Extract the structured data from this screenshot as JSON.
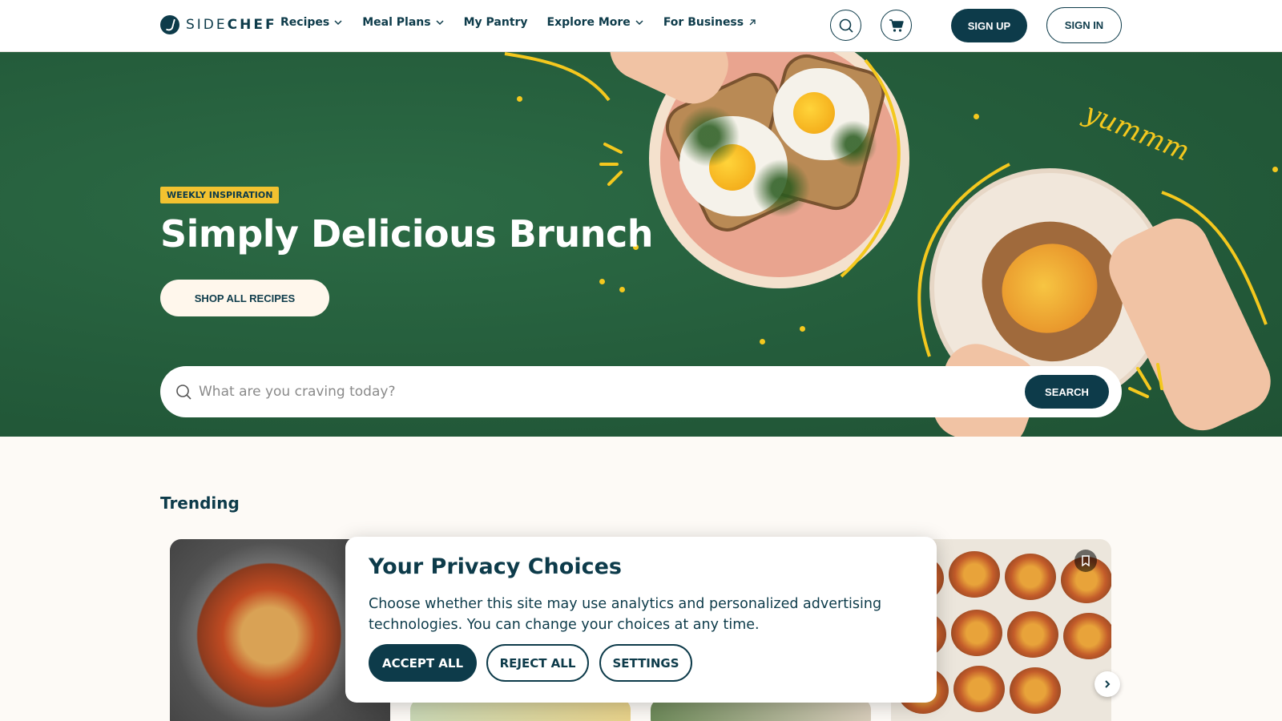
{
  "brand": {
    "light": "SIDE",
    "bold": "CHEF"
  },
  "nav": {
    "items": [
      {
        "label": "Recipes",
        "has_dropdown": true
      },
      {
        "label": "Meal Plans",
        "has_dropdown": true
      },
      {
        "label": "My Pantry",
        "has_dropdown": false
      },
      {
        "label": "Explore More",
        "has_dropdown": true
      },
      {
        "label": "For Business",
        "external": true
      }
    ],
    "sign_up": "SIGN UP",
    "sign_in": "SIGN IN",
    "icons": [
      "search-icon",
      "cart-icon"
    ]
  },
  "hero": {
    "badge": "WEEKLY INSPIRATION",
    "title": "Simply Delicious Brunch",
    "cta": "SHOP ALL RECIPES",
    "decor_text": "yummm",
    "search": {
      "placeholder": "What are you craving today?",
      "button": "SEARCH"
    }
  },
  "trending": {
    "title": "Trending"
  },
  "privacy": {
    "title": "Your Privacy Choices",
    "body": "Choose whether this site may use analytics and personalized advertising technologies. You can change your choices at any time.",
    "accept": "ACCEPT ALL",
    "reject": "REJECT ALL",
    "settings": "SETTINGS"
  },
  "colors": {
    "brand_navy": "#0d3b4a",
    "hero_green": "#245c3b",
    "accent_yellow": "#f4c81e",
    "background": "#fdfaf6"
  }
}
